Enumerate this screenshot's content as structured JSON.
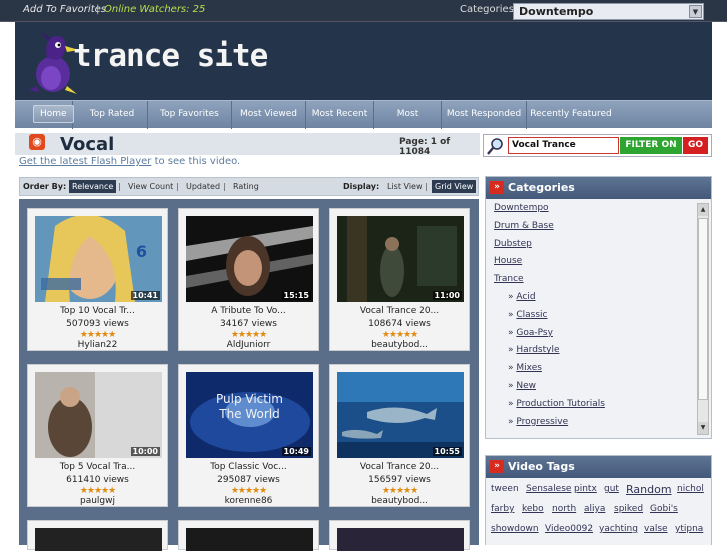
{
  "topbar": {
    "favorites_link": "Add To Favorites",
    "separator": "|",
    "online_watchers": "Online Watchers: 25",
    "categories_label": "Categories",
    "category_selected": "Downtempo"
  },
  "header": {
    "site_title": "trance site"
  },
  "nav": {
    "items": [
      "Home",
      "Top Rated",
      "Top Favorites",
      "Most Viewed",
      "Most Recent",
      "Most Discussed",
      "Most Responded",
      "Recently Featured"
    ]
  },
  "page": {
    "title": "Vocal",
    "page_info": "Page: 1 of 11084",
    "flash_link": "Get the latest Flash Player",
    "flash_rest": " to see this video."
  },
  "search": {
    "value": "Vocal Trance",
    "filter_label": "FILTER ON",
    "go_label": "GO"
  },
  "order": {
    "label": "Order By:",
    "options": [
      "Relevance",
      "View Count",
      "Updated",
      "Rating"
    ],
    "display_label": "Display:",
    "display_options": [
      "List View",
      "Grid View"
    ]
  },
  "videos": [
    {
      "title": "Top 10 Vocal Tr...",
      "views": "507093 views",
      "user": "Hylian22",
      "duration": "10:41",
      "rating": 5
    },
    {
      "title": "A Tribute To Vo...",
      "views": "34167 views",
      "user": "AldJuniorr",
      "duration": "15:15",
      "rating": 5
    },
    {
      "title": "Vocal Trance 20...",
      "views": "108674 views",
      "user": "beautybod...",
      "duration": "11:00",
      "rating": 5
    },
    {
      "title": "Top 5 Vocal Tra...",
      "views": "611410 views",
      "user": "paulgwj",
      "duration": "10:00",
      "rating": 5
    },
    {
      "title": "Top Classic Voc...",
      "views": "295087 views",
      "user": "korenne86",
      "duration": "10:49",
      "rating": 5
    },
    {
      "title": "Vocal Trance 20...",
      "views": "156597 views",
      "user": "beautybod...",
      "duration": "10:55",
      "rating": 5
    }
  ],
  "thumb_texts": {
    "v1_number": "6",
    "v5_caption_1": "Pulp Victim",
    "v5_caption_2": "The World"
  },
  "categories_box": {
    "title": "Categories",
    "items": [
      "Downtempo",
      "Drum & Base",
      "Dubstep",
      "House",
      "Trance"
    ],
    "subitems": [
      "Acid",
      "Classic",
      "Goa-Psy",
      "Hardstyle",
      "Mixes",
      "New",
      "Production Tutorials",
      "Progressive"
    ]
  },
  "tags_box": {
    "title": "Video Tags",
    "tags": [
      "tween",
      "Sensalese",
      "pintx",
      "gut",
      "Random",
      "nichol",
      "farby",
      "kebo",
      "north",
      "aliya",
      "spiked",
      "Gobi's",
      "showdown",
      "Video0092",
      "yachting",
      "valse",
      "ytipna"
    ]
  },
  "colors": {
    "header_bg": "#24344a",
    "accent_green": "#2ea531",
    "accent_red": "#d42020",
    "grid_bg": "#5a6e89",
    "watchers_green": "#b8e04a"
  },
  "icons": {
    "rss": "rss-icon",
    "search": "magnifier-icon",
    "categories": "double-chevron-icon",
    "tags": "double-chevron-icon"
  }
}
